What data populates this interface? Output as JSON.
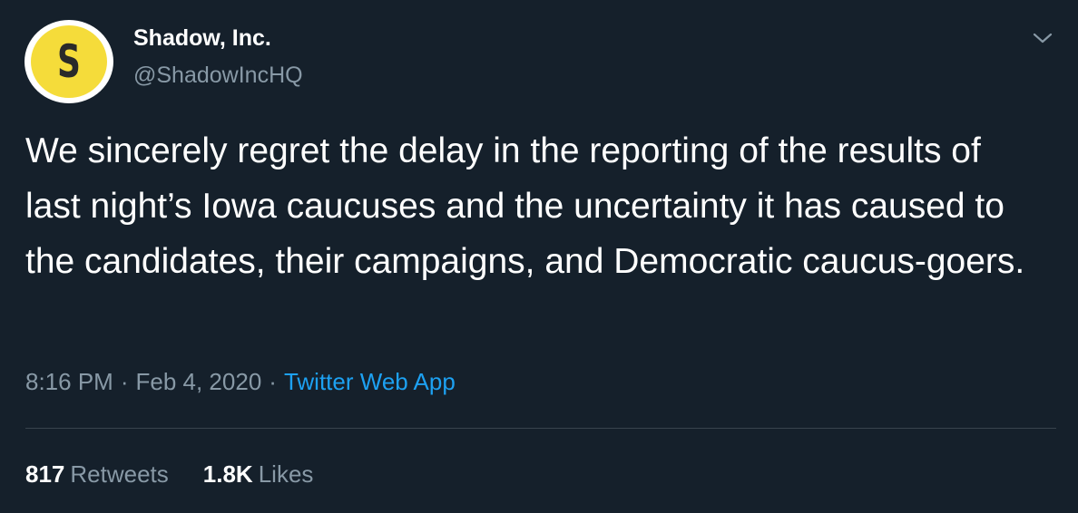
{
  "author": {
    "display_name": "Shadow, Inc.",
    "handle": "@ShadowIncHQ",
    "avatar_letter": "S",
    "avatar_color": "#f5dc3a"
  },
  "tweet": {
    "text": "We sincerely regret the delay in the reporting of the results of last night’s Iowa caucuses and the uncertainty it has caused to the candidates, their campaigns, and Democratic caucus-goers.",
    "time": "8:16 PM",
    "date": "Feb 4, 2020",
    "source": "Twitter Web App",
    "separator": "·"
  },
  "stats": {
    "retweets_count": "817",
    "retweets_label": "Retweets",
    "likes_count": "1.8K",
    "likes_label": "Likes"
  },
  "icons": {
    "menu": "chevron-down-icon"
  },
  "colors": {
    "background": "#15202b",
    "primary_text": "#ffffff",
    "secondary_text": "#8899a6",
    "link": "#1da1f2",
    "divider": "#38444d"
  }
}
